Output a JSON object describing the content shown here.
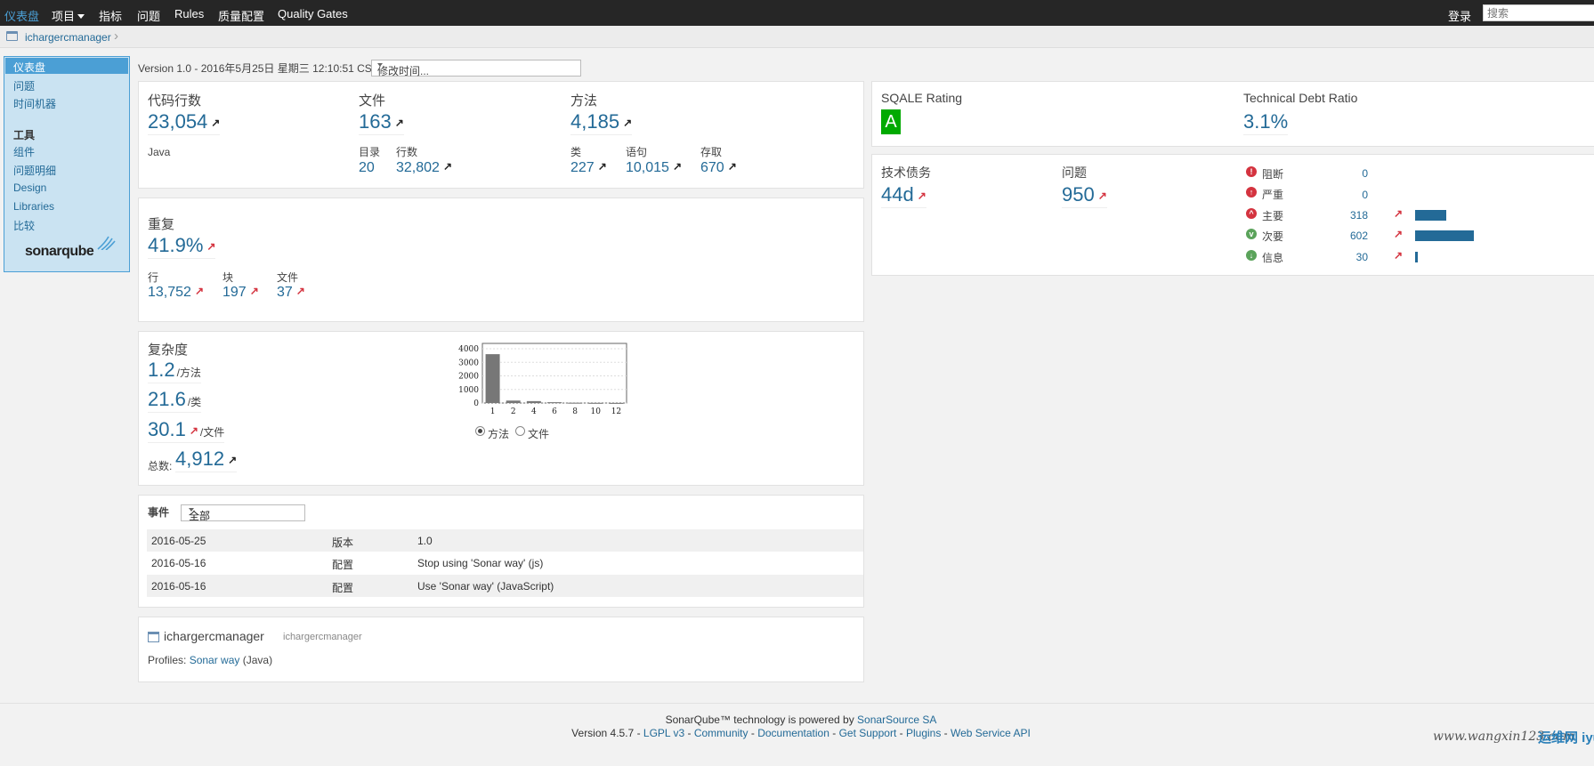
{
  "nav": {
    "items": [
      "仪表盘",
      "项目",
      "指标",
      "问题",
      "Rules",
      "质量配置",
      "Quality Gates"
    ],
    "login": "登录",
    "search_placeholder": "搜索"
  },
  "breadcrumb": {
    "project": "ichargercmanager"
  },
  "sidebar": {
    "items": [
      "仪表盘",
      "问题",
      "时间机器"
    ],
    "tools_header": "工具",
    "tools": [
      "组件",
      "问题明细",
      "Design",
      "Libraries",
      "比较"
    ],
    "logo": "sonarqube"
  },
  "version": {
    "line": "Version 1.0 - 2016年5月25日 星期三 12:10:51 CST",
    "compare": "修改时间..."
  },
  "size": {
    "loc_title": "代码行数",
    "loc": "23,054",
    "language": "Java",
    "files_title": "文件",
    "files": "163",
    "dirs_label": "目录",
    "dirs": "20",
    "lines_label": "行数",
    "lines": "32,802",
    "methods_title": "方法",
    "methods": "4,185",
    "classes_label": "类",
    "classes": "227",
    "statements_label": "语句",
    "statements": "10,015",
    "accessors_label": "存取",
    "accessors": "670"
  },
  "duplication": {
    "title": "重复",
    "pct": "41.9%",
    "lines_label": "行",
    "lines": "13,752",
    "blocks_label": "块",
    "blocks": "197",
    "files_label": "文件",
    "files": "37"
  },
  "complexity": {
    "title": "复杂度",
    "per_method": "1.2",
    "per_method_unit": "/方法",
    "per_class": "21.6",
    "per_class_unit": "/类",
    "per_file": "30.1",
    "per_file_unit": "/文件",
    "total_label": "总数:",
    "total": "4,912",
    "radio_method": "方法",
    "radio_file": "文件"
  },
  "chart_data": {
    "type": "bar",
    "categories": [
      "1",
      "2",
      "4",
      "6",
      "8",
      "10",
      "12"
    ],
    "values": [
      3600,
      180,
      140,
      60,
      20,
      10,
      5
    ],
    "ylim": [
      0,
      4000
    ],
    "yticks": [
      "4000",
      "3000",
      "2000",
      "1000",
      "0"
    ],
    "title": "",
    "xlabel": "",
    "ylabel": ""
  },
  "events": {
    "title": "事件",
    "filter": "全部",
    "rows": [
      {
        "date": "2016-05-25",
        "category": "版本",
        "name": "1.0"
      },
      {
        "date": "2016-05-16",
        "category": "配置",
        "name": "Stop using 'Sonar way' (js)"
      },
      {
        "date": "2016-05-16",
        "category": "配置",
        "name": "Use 'Sonar way' (JavaScript)"
      }
    ]
  },
  "project_desc": {
    "name": "ichargercmanager",
    "key": "ichargercmanager",
    "profiles_label": "Profiles:",
    "profile": "Sonar way",
    "profile_lang": "(Java)"
  },
  "sqale": {
    "rating_label": "SQALE Rating",
    "rating": "A",
    "rating_color": "#00aa00",
    "ratio_label": "Technical Debt Ratio",
    "ratio": "3.1%"
  },
  "debt": {
    "title": "技术债务",
    "value": "44d",
    "issues_title": "问题",
    "issues": "950",
    "severities": [
      {
        "label": "阻断",
        "count": "0",
        "fraction": 0,
        "color": "#d4333f",
        "icon": "blocker-icon"
      },
      {
        "label": "严重",
        "count": "0",
        "fraction": 0,
        "color": "#d4333f",
        "icon": "critical-icon"
      },
      {
        "label": "主要",
        "count": "318",
        "fraction": 0.53,
        "color": "#d4333f",
        "icon": "major-icon"
      },
      {
        "label": "次要",
        "count": "602",
        "fraction": 1.0,
        "color": "#5ba35b",
        "icon": "minor-icon"
      },
      {
        "label": "信息",
        "count": "30",
        "fraction": 0.05,
        "color": "#5ba35b",
        "icon": "info-icon"
      }
    ]
  },
  "footer": {
    "line1_a": "SonarQube™ technology is powered by",
    "line1_link": "SonarSource SA",
    "version": "Version 4.5.7",
    "links": [
      "LGPL v3",
      "Community",
      "Documentation",
      "Get Support",
      "Plugins",
      "Web Service API"
    ]
  },
  "watermark": {
    "url": "www.wangxin123.com",
    "site": "运维网 iyunv.com"
  }
}
